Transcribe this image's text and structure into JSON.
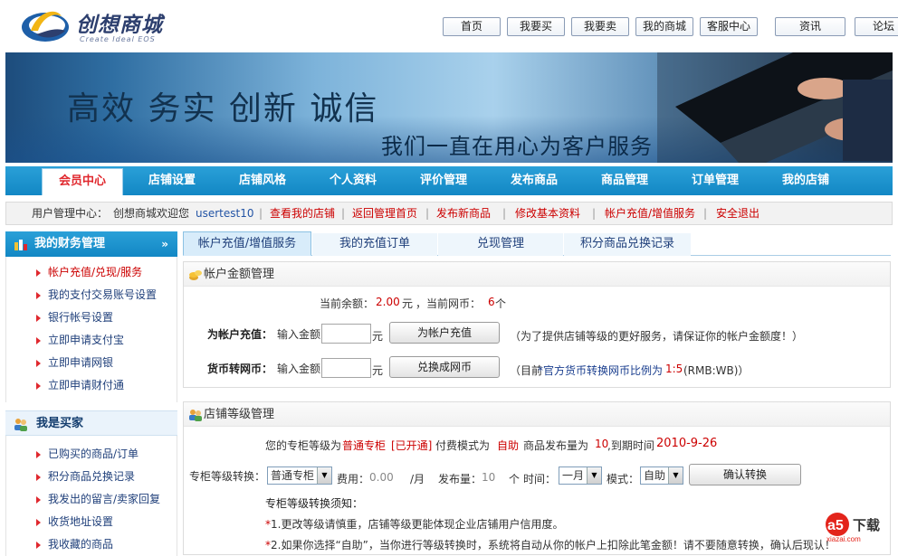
{
  "header": {
    "logo_title": "创想商城",
    "logo_sub": "Create Ideal EOS",
    "topnav": [
      "首页",
      "我要买",
      "我要卖",
      "我的商城",
      "客服中心",
      "资讯",
      "论坛"
    ]
  },
  "banner": {
    "slogan": "高效 务实 创新 诚信",
    "sub": "我们一直在用心为客户服务"
  },
  "mainnav": [
    "会员中心",
    "店铺设置",
    "店铺风格",
    "个人资料",
    "评价管理",
    "发布商品",
    "商品管理",
    "订单管理",
    "我的店铺"
  ],
  "crumb": {
    "prefix": "用户管理中心：",
    "welcome": "创想商城欢迎您",
    "username": "usertest10",
    "sep": "|",
    "links": [
      "查看我的店铺",
      "返回管理首页",
      "发布新商品",
      "修改基本资料",
      "帐户充值/增值服务",
      "安全退出"
    ]
  },
  "sidebar": {
    "finance": {
      "title": "我的财务管理",
      "chevron": "»",
      "items": [
        "帐户充值/兑现/服务",
        "我的支付交易账号设置",
        "银行帐号设置",
        "立即申请支付宝",
        "立即申请网银",
        "立即申请财付通"
      ]
    },
    "buyer": {
      "title": "我是买家",
      "items": [
        "已购买的商品/订单",
        "积分商品兑换记录",
        "我发出的留言/卖家回复",
        "收货地址设置",
        "我收藏的商品"
      ]
    }
  },
  "tabs": [
    "帐户充值/增值服务",
    "我的充值订单",
    "兑现管理",
    "积分商品兑换记录"
  ],
  "account": {
    "title": "帐户金额管理",
    "balance_label": "当前余额：",
    "balance_value": "2.00",
    "balance_unit": "元",
    "coin_label": "，当前网币：",
    "coin_value": "6",
    "coin_unit": "个",
    "recharge_label": "为帐户充值：",
    "input_amount": "输入金额",
    "yuan": "元",
    "recharge_btn": "为帐户充值",
    "recharge_note": "（为了提供店铺等级的更好服务，请保证你的帐户金额度！）",
    "convert_label": "货币转网币：",
    "convert_btn": "兑换成网币",
    "convert_note_a": "（目前",
    "convert_note_b": "*官方货币转换网币比例为",
    "convert_ratio": "1:5",
    "convert_note_c": "(RMB:WB)）"
  },
  "level": {
    "title": "店铺等级管理",
    "line_a": "您的专柜等级为",
    "level_name": "普通专柜",
    "opened": "[已开通]",
    "line_b": "付费模式为",
    "mode": "自助",
    "line_c": "商品发布量为",
    "count": "10",
    "line_d": ",到期时间",
    "expire": "2010-9-26",
    "convert_label": "专柜等级转换：",
    "level_select": "普通专柜",
    "fee_label": "费用：",
    "fee_value": "0.00",
    "per_month": "/月",
    "publish_label": "发布量：",
    "publish_value": "10",
    "publish_unit": "个",
    "time_label": "时间：",
    "time_select": "一月",
    "mode_label": "模式：",
    "mode_select": "自助",
    "confirm_btn": "确认转换",
    "notice_title": "专柜等级转换须知：",
    "notice_1": "1.更改等级请慎重，店铺等级更能体现企业店铺用户信用度。",
    "notice_2": "2.如果你选择“自助”，当你进行等级转换时，系统将自动从你的帐户上扣除此笔金额！请不要随意转换，确认后现认！"
  },
  "watermark": {
    "brand": "a5",
    "text": "下载",
    "site": "xiazai.com"
  }
}
